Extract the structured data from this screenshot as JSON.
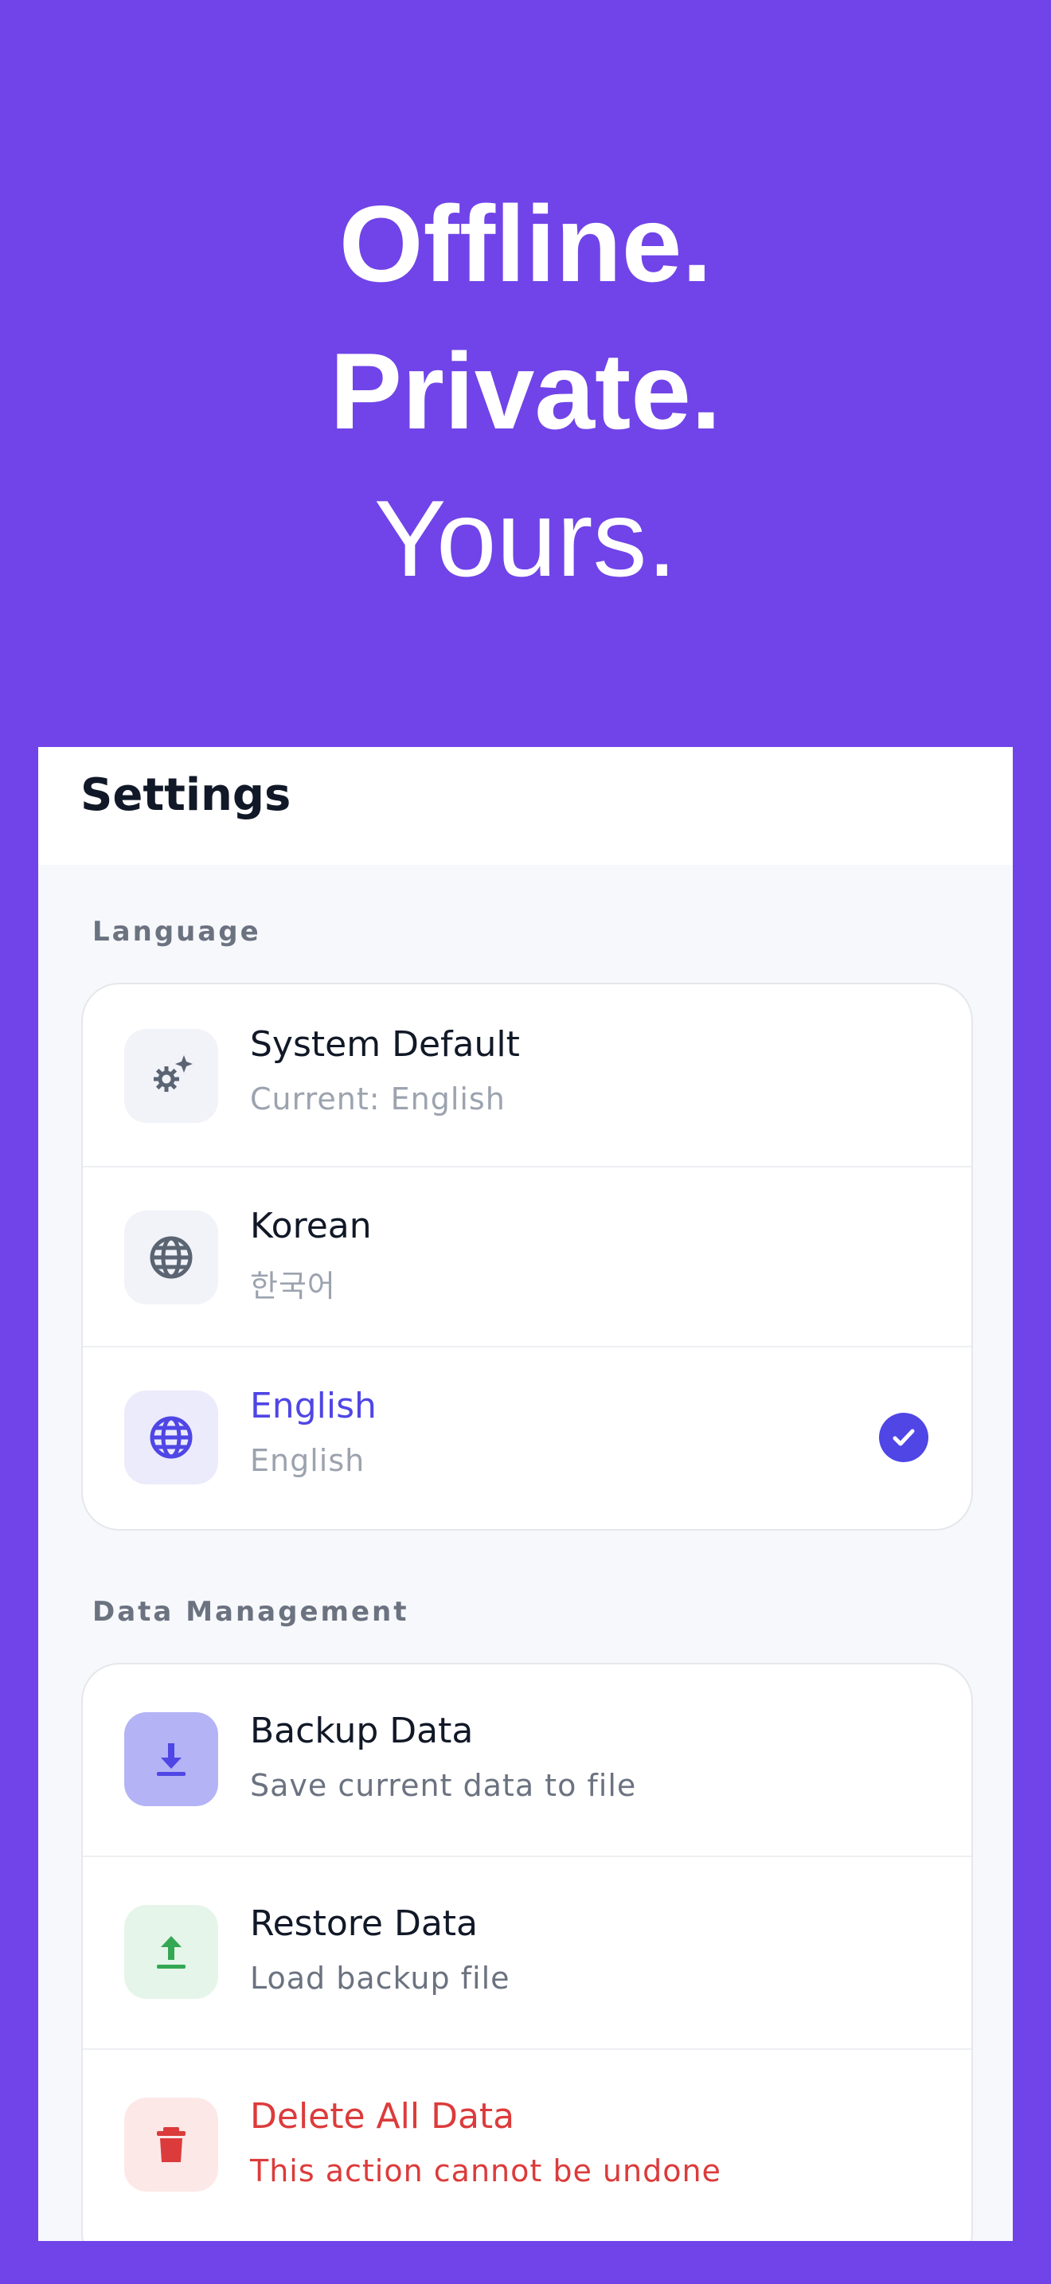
{
  "hero": {
    "line1": "Offline.",
    "line2": "Private.",
    "line3": "Yours."
  },
  "header": {
    "title": "Settings"
  },
  "language": {
    "label": "Language",
    "items": [
      {
        "title": "System Default",
        "subtitle": "Current: English",
        "icon": "gear-sparkle-icon"
      },
      {
        "title": "Korean",
        "subtitle": "한국어",
        "icon": "globe-icon"
      },
      {
        "title": "English",
        "subtitle": "English",
        "icon": "globe-icon",
        "selected": true
      }
    ]
  },
  "data_management": {
    "label": "Data Management",
    "items": [
      {
        "title": "Backup Data",
        "subtitle": "Save current data to file",
        "icon": "download-icon"
      },
      {
        "title": "Restore Data",
        "subtitle": "Load backup file",
        "icon": "upload-icon"
      },
      {
        "title": "Delete All Data",
        "subtitle": "This action cannot be undone",
        "icon": "trash-icon"
      }
    ]
  },
  "colors": {
    "background": "#7044e8",
    "accent": "#4f46e5",
    "danger": "#dc3b3b",
    "success": "#34a853"
  }
}
